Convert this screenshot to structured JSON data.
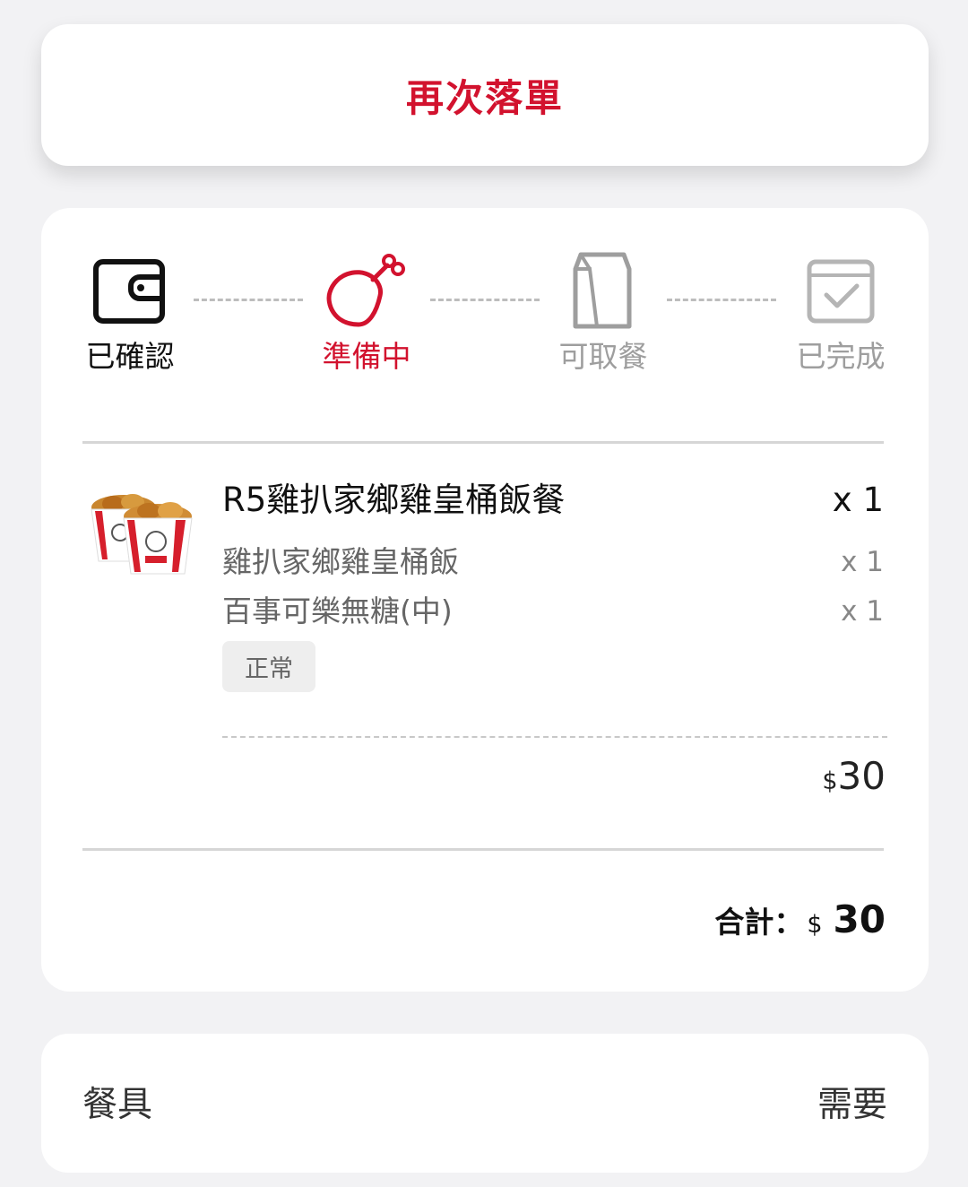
{
  "reorder_button": {
    "label": "再次落單",
    "color": "#d2122e"
  },
  "order_status": {
    "current_step": 1,
    "steps": [
      {
        "label": "已確認",
        "icon": "wallet-icon",
        "state": "done",
        "color": "#111111"
      },
      {
        "label": "準備中",
        "icon": "chicken-drumstick-icon",
        "state": "active",
        "color": "#d2122e"
      },
      {
        "label": "可取餐",
        "icon": "food-bag-icon",
        "state": "pending",
        "color": "#9e9e9e"
      },
      {
        "label": "已完成",
        "icon": "calendar-check-icon",
        "state": "pending",
        "color": "#9e9e9e"
      }
    ]
  },
  "order_item": {
    "image_icon": "chicken-bucket-image",
    "name": "R5雞扒家鄉雞皇桶飯餐",
    "quantity": "x 1",
    "sub_items": [
      {
        "name": "雞扒家鄉雞皇桶飯",
        "quantity": "x 1"
      },
      {
        "name": "百事可樂無糖(中)",
        "quantity": "x 1"
      }
    ],
    "tag": "正常",
    "price_currency": "$",
    "price_value": "30"
  },
  "total": {
    "label": "合計：",
    "currency": "$",
    "value": "30"
  },
  "utensils": {
    "label": "餐具",
    "value": "需要"
  }
}
